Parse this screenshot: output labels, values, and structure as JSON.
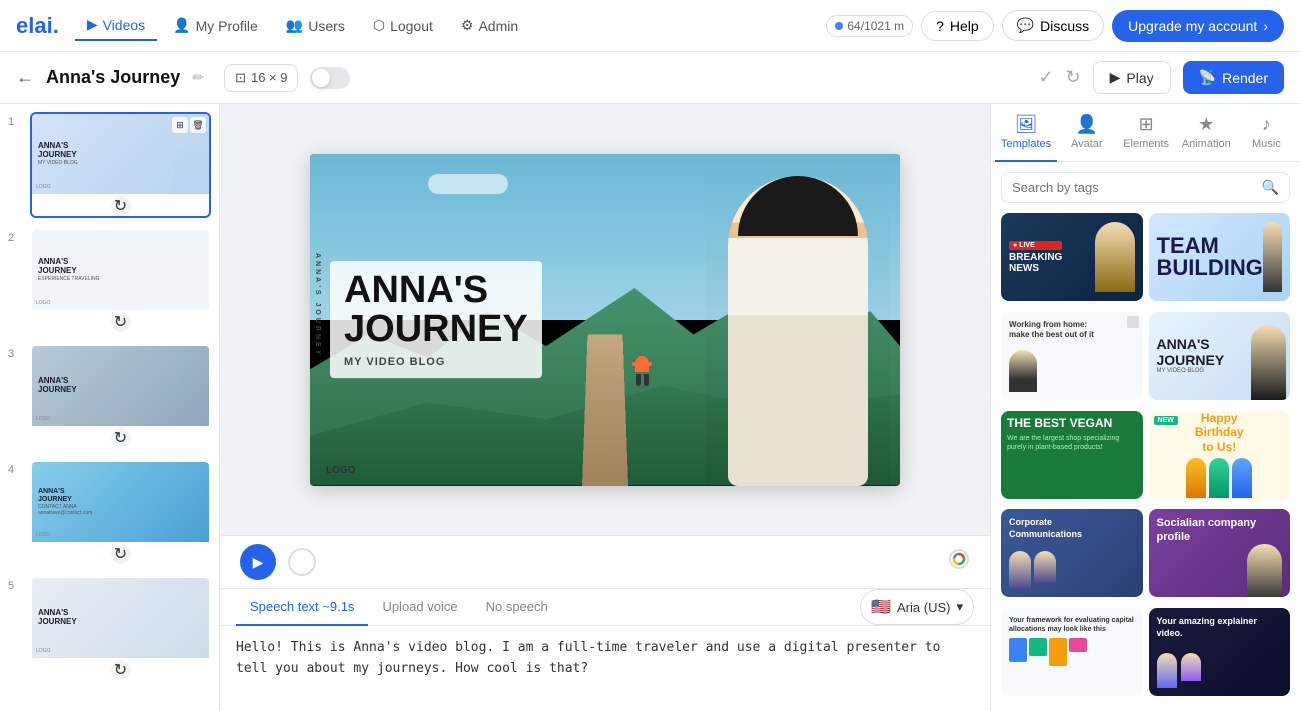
{
  "topnav": {
    "logo": "elai.",
    "items": [
      {
        "id": "videos",
        "label": "Videos",
        "icon": "▶",
        "active": true
      },
      {
        "id": "my-profile",
        "label": "My Profile",
        "icon": "👤"
      },
      {
        "id": "users",
        "label": "Users",
        "icon": "👥"
      },
      {
        "id": "logout",
        "label": "Logout",
        "icon": "⬡"
      },
      {
        "id": "admin",
        "label": "Admin",
        "icon": "⚙"
      }
    ],
    "usage": {
      "text": "64/1021 m",
      "dot_color": "#3b82f6"
    },
    "help_label": "Help",
    "discuss_label": "Discuss",
    "upgrade_label": "Upgrade my account"
  },
  "subheader": {
    "back_label": "←",
    "title": "Anna's Journey",
    "aspect_ratio": "16 × 9",
    "play_label": "Play",
    "render_label": "Render"
  },
  "slides": [
    {
      "num": "1",
      "type": "slide1",
      "title": "ANNA'S",
      "subtitle": "JOURNEY",
      "sub2": "MY VIDEO BLOG",
      "logo": "LOGO",
      "active": true
    },
    {
      "num": "2",
      "type": "slide2",
      "title": "ANNA'S",
      "subtitle": "JOURNEY",
      "sub2": "EXPERIENCE TRAVELING",
      "logo": "LOGO",
      "active": false
    },
    {
      "num": "3",
      "type": "slide3",
      "title": "ANNA'S",
      "subtitle": "JOURNEY",
      "sub2": "",
      "logo": "LOGO",
      "active": false
    },
    {
      "num": "4",
      "type": "slide4",
      "title": "ANNA'S",
      "subtitle": "JOURNEY",
      "sub2": "CONTACT ANNA",
      "logo": "LOGO",
      "active": false
    },
    {
      "num": "5",
      "type": "slide5",
      "title": "ANNA'S",
      "subtitle": "JOURNEY",
      "sub2": "",
      "logo": "LOGO",
      "active": false
    }
  ],
  "canvas": {
    "title_line1": "ANNA'S",
    "title_line2": "JOURNEY",
    "subtitle": "MY VIDEO BLOG",
    "logo": "LOGO",
    "vertical_text": "ANNA'S JOURNEY"
  },
  "speech": {
    "tab_speech": "Speech text ~9.1s",
    "tab_upload": "Upload voice",
    "tab_no_speech": "No speech",
    "voice_name": "Aria (US)",
    "speech_text": "Hello! This is Anna's video blog. I am a full-time traveler and use a digital presenter to tell you about my journeys. How cool is that?"
  },
  "right_panel": {
    "tabs": [
      {
        "id": "templates",
        "label": "Templates",
        "icon": "🖼",
        "active": true
      },
      {
        "id": "avatar",
        "label": "Avatar",
        "icon": "👤"
      },
      {
        "id": "elements",
        "label": "Elements",
        "icon": "⊞"
      },
      {
        "id": "animation",
        "label": "Animation",
        "icon": "★"
      },
      {
        "id": "music",
        "label": "Music",
        "icon": "♪"
      }
    ],
    "search_placeholder": "Search by tags",
    "templates": [
      {
        "id": "breaking-news",
        "type": "breaking",
        "title": "BREAKING NEWS"
      },
      {
        "id": "team-building",
        "type": "team",
        "title": "TEAM BUILDING"
      },
      {
        "id": "work-from-home",
        "type": "wfh",
        "title": "Working from home: make the best out of it",
        "badge": ""
      },
      {
        "id": "annas-journey",
        "type": "journey",
        "title": "ANNA'S JOURNEY",
        "badge": ""
      },
      {
        "id": "best-vegan",
        "type": "vegan",
        "title": "THE BEST VEGAN",
        "sub": "We are the largest shop specializing purely in plant-based products!"
      },
      {
        "id": "happy-birthday",
        "type": "birthday",
        "title": "Happy Birthday to Us!",
        "badge": "NEW"
      },
      {
        "id": "corporate-comms",
        "type": "corporate",
        "title": "Corporate Communications"
      },
      {
        "id": "socialian-company",
        "type": "social",
        "title": "Socialian company profile"
      },
      {
        "id": "framework",
        "type": "framework",
        "title": "Your framework for evaluating capital allocations may look like this"
      },
      {
        "id": "explainer",
        "type": "explainer",
        "title": "Your amazing explainer video."
      }
    ]
  }
}
